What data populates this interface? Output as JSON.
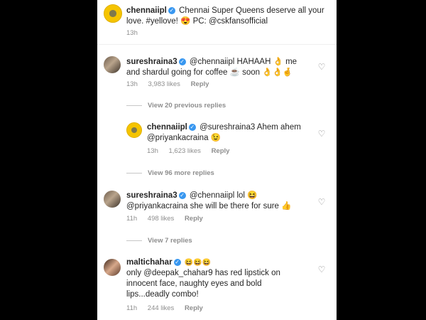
{
  "comments": {
    "c1": {
      "username": "chennaiipl",
      "text": "Chennai Super Queens deserve all your love. #yellove! 😍 PC: @cskfansofficial",
      "time": "13h"
    },
    "c2": {
      "username": "sureshraina3",
      "text": "@chennaiipl HAHAAH 👌 me and shardul going for coffee ☕ soon 👌👌🤞",
      "time": "13h",
      "likes": "3,983 likes",
      "reply": "Reply"
    },
    "view_previous": "View 20 previous replies",
    "c3": {
      "username": "chennaiipl",
      "text": "@sureshraina3 Ahem ahem @priyankacraina 😉",
      "time": "13h",
      "likes": "1,623 likes",
      "reply": "Reply"
    },
    "view_more": "View 96 more replies",
    "c4": {
      "username": "sureshraina3",
      "text": "@chennaiipl lol 😆 @priyankacraina she will be there for sure 👍",
      "time": "11h",
      "likes": "498 likes",
      "reply": "Reply"
    },
    "view_replies": "View 7 replies",
    "c5": {
      "username": "maltichahar",
      "emojis": "😆😆😆",
      "text": "only @deepak_chahar9 has red lipstick on innocent face, naughty eyes and bold lips...deadly combo!",
      "time": "11h",
      "likes": "244 likes",
      "reply": "Reply"
    }
  },
  "colors": {
    "verified": "#3897f0",
    "meta": "#8e8e8e",
    "csk": "#f5c400"
  },
  "icons": {
    "heart": "heart-outline-icon",
    "verified": "verified-badge-icon"
  }
}
